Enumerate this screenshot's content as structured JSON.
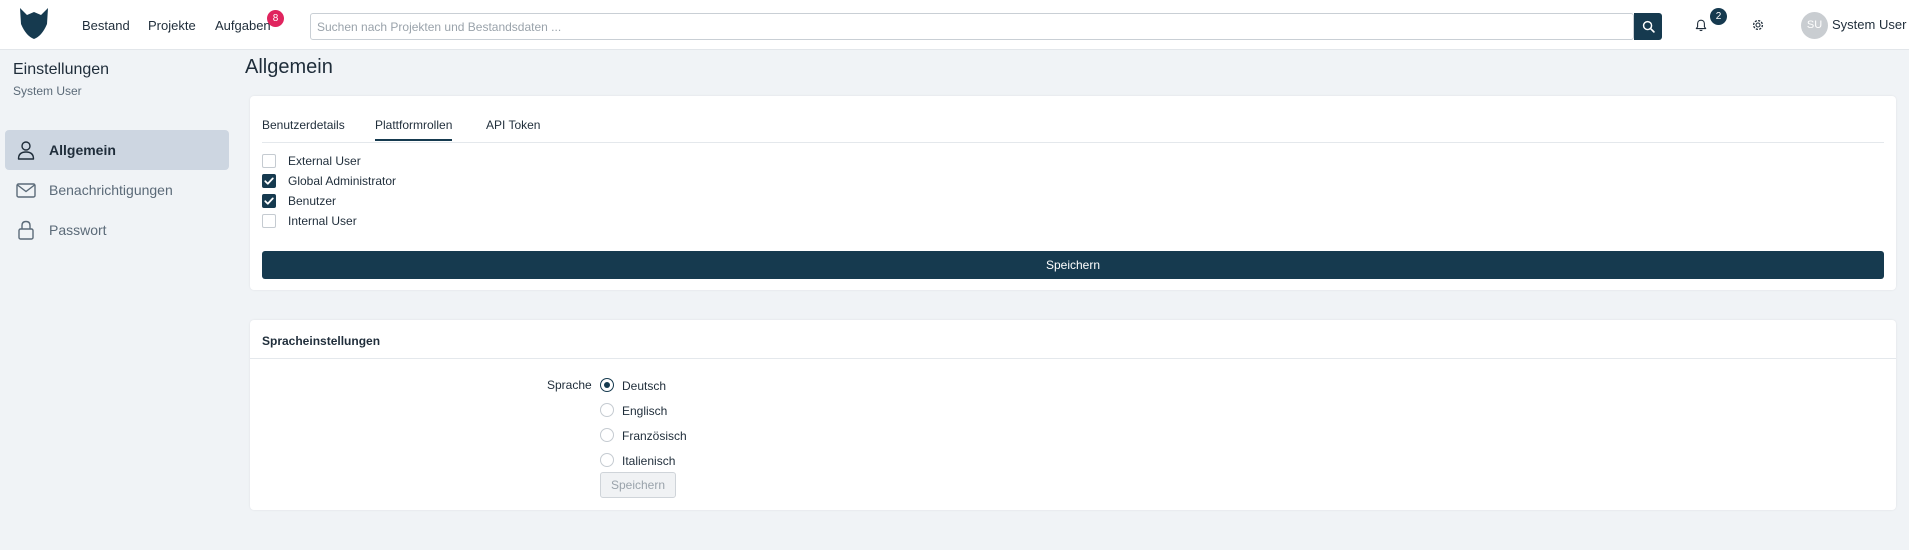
{
  "nav": {
    "links": [
      "Bestand",
      "Projekte",
      "Aufgaben"
    ],
    "tasks_badge": "8",
    "search_placeholder": "Suchen nach Projekten und Bestandsdaten ...",
    "notifications_badge": "2",
    "user_initials": "SU",
    "user_name": "System User"
  },
  "sidebar": {
    "title": "Einstellungen",
    "subtitle": "System User",
    "items": [
      {
        "label": "Allgemein",
        "icon": "user-icon",
        "active": true
      },
      {
        "label": "Benachrichtigungen",
        "icon": "mail-icon",
        "active": false
      },
      {
        "label": "Passwort",
        "icon": "lock-icon",
        "active": false
      }
    ]
  },
  "main": {
    "title": "Allgemein",
    "tabs": [
      {
        "label": "Benutzerdetails",
        "active": false
      },
      {
        "label": "Plattformrollen",
        "active": true
      },
      {
        "label": "API Token",
        "active": false
      }
    ],
    "roles": [
      {
        "label": "External User",
        "checked": false
      },
      {
        "label": "Global Administrator",
        "checked": true
      },
      {
        "label": "Benutzer",
        "checked": true
      },
      {
        "label": "Internal User",
        "checked": false
      }
    ],
    "save_label": "Speichern"
  },
  "language": {
    "section_title": "Spracheinstellungen",
    "field_label": "Sprache",
    "options": [
      {
        "label": "Deutsch",
        "selected": true
      },
      {
        "label": "Englisch",
        "selected": false
      },
      {
        "label": "Französisch",
        "selected": false
      },
      {
        "label": "Italienisch",
        "selected": false
      }
    ],
    "save_label": "Speichern"
  },
  "colors": {
    "primary": "#163a4f",
    "badge_red": "#e0245e",
    "sidebar_active": "#cdd6e1",
    "background": "#f0f3f6"
  }
}
